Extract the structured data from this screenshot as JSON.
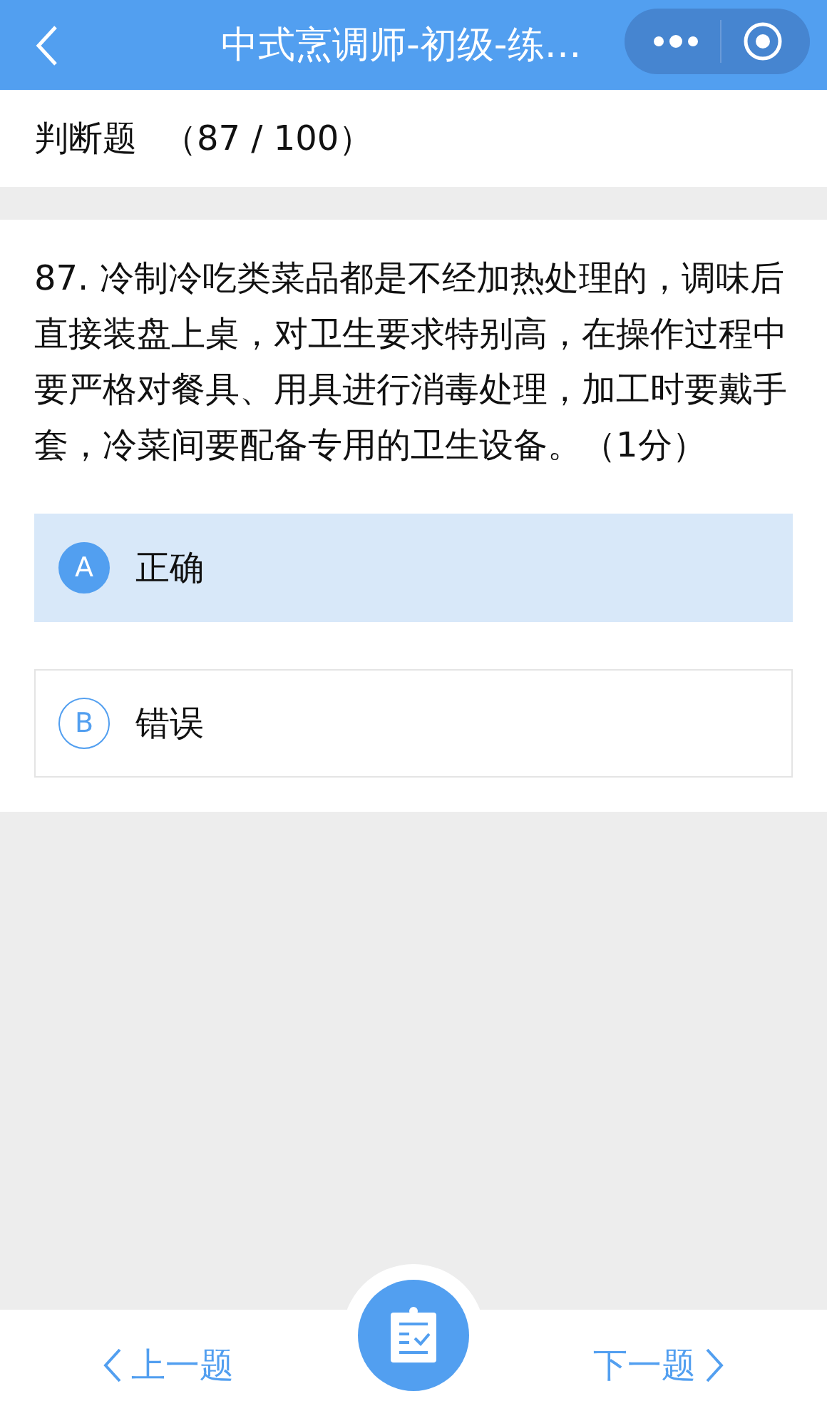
{
  "nav": {
    "title": "中式烹调师-初级-练…"
  },
  "section": {
    "label": "判断题",
    "progress": "（87 / 100）"
  },
  "question": {
    "text": "87. 冷制冷吃类菜品都是不经加热处理的，调味后直接装盘上桌，对卫生要求特别高，在操作过程中要严格对餐具、用具进行消毒处理，加工时要戴手套，冷菜间要配备专用的卫生设备。（1分）"
  },
  "options": [
    {
      "letter": "A",
      "text": "正确",
      "selected": true
    },
    {
      "letter": "B",
      "text": "错误",
      "selected": false
    }
  ],
  "bottom": {
    "prev": "上一题",
    "next": "下一题"
  }
}
